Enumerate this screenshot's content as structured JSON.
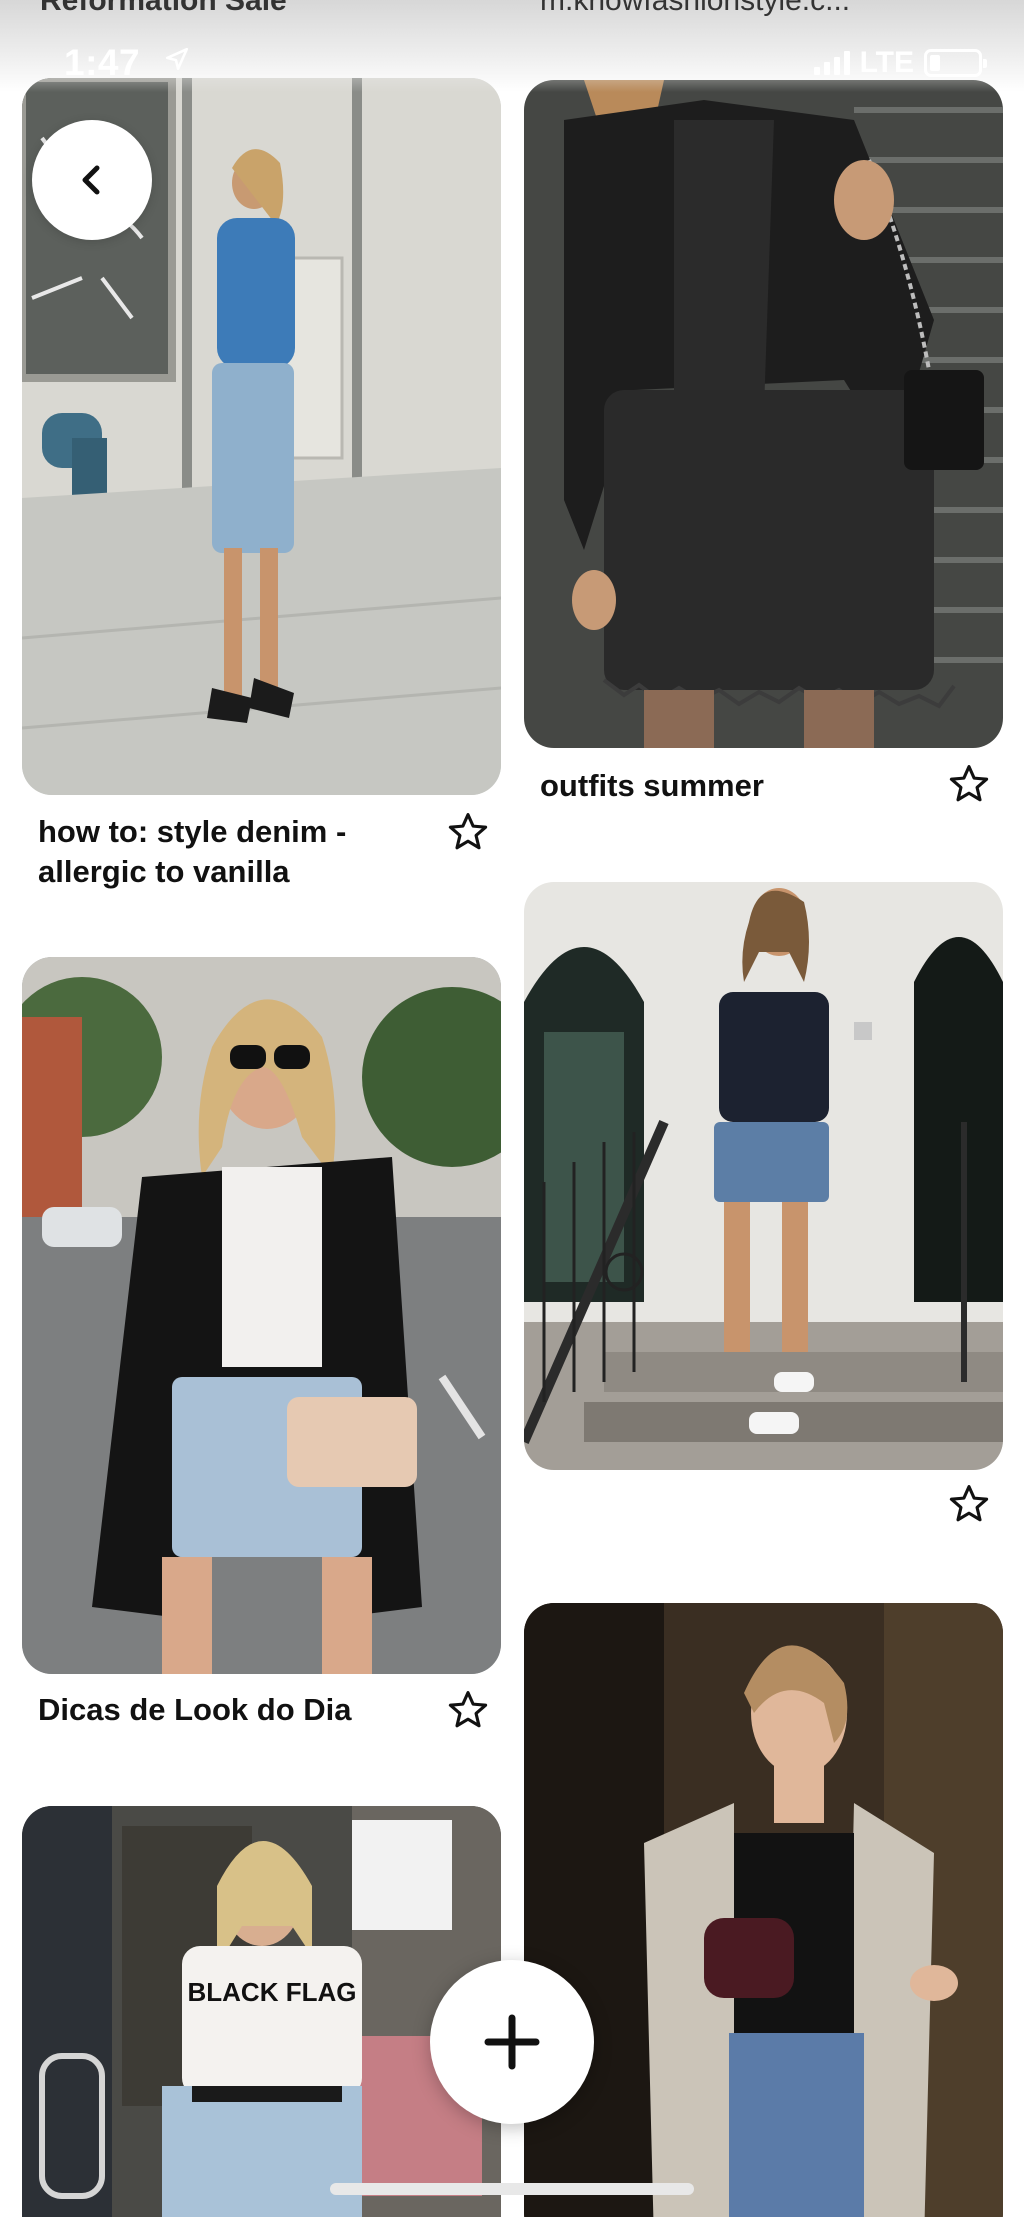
{
  "top_cut_left": "Reformation Sale",
  "top_cut_right": "m.knowfashionstyle.c...",
  "status": {
    "time": "1:47",
    "network": "LTE",
    "icons": [
      "location-arrow-icon",
      "signal-bars-icon",
      "battery-icon"
    ]
  },
  "buttons": {
    "back_icon": "chevron-left-icon",
    "add_icon": "plus-icon"
  },
  "pins": [
    {
      "id": "denim-skirt-street",
      "title_line1": "how to: style denim -",
      "title_line2": "allergic to vanilla",
      "saved": false
    },
    {
      "id": "leather-jacket",
      "title": "outfits summer",
      "saved": false
    },
    {
      "id": "black-blazer",
      "title": "Dicas de Look do Dia",
      "saved": false
    },
    {
      "id": "steps-denim-skirt",
      "title": "",
      "saved": false
    },
    {
      "id": "graphic-tee",
      "title": ""
    },
    {
      "id": "cardigan-lace",
      "title": ""
    }
  ],
  "graphic_tee_text": "BLACK FLAG",
  "colors": {
    "background": "#ffffff",
    "text": "#111111",
    "icon": "#111111"
  }
}
